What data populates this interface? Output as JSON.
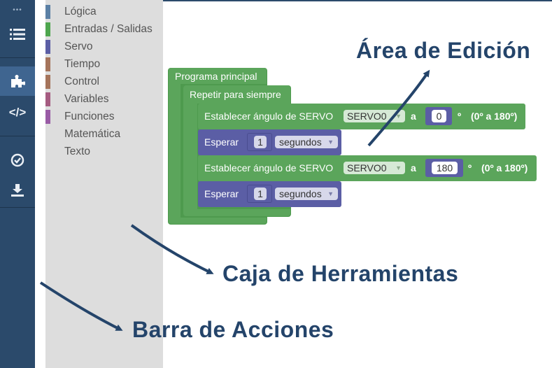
{
  "actionbar": {
    "buttons": [
      {
        "name": "menu-dots-icon",
        "glyph": "•••"
      },
      {
        "name": "list-icon",
        "glyph": "☰"
      },
      {
        "name": "puzzle-icon",
        "glyph": "✚"
      },
      {
        "name": "code-icon",
        "glyph": "</>"
      },
      {
        "name": "check-circle-icon",
        "glyph": "✔"
      },
      {
        "name": "download-icon",
        "glyph": "⤓"
      }
    ]
  },
  "toolbox": {
    "categories": [
      {
        "label": "Lógica",
        "color": "#5b80a5"
      },
      {
        "label": "Entradas / Salidas",
        "color": "#4ea64e"
      },
      {
        "label": "Servo",
        "color": "#5b5ea5"
      },
      {
        "label": "Tiempo",
        "color": "#a5745b"
      },
      {
        "label": "Control",
        "color": "#a5745b"
      },
      {
        "label": "Variables",
        "color": "#a55b80"
      },
      {
        "label": "Funciones",
        "color": "#995ba5"
      },
      {
        "label": "Matemática",
        "color": ""
      },
      {
        "label": "Texto",
        "color": ""
      }
    ]
  },
  "workspace": {
    "program_label": "Programa principal",
    "loop_label": "Repetir para siempre",
    "blocks": [
      {
        "type": "servo",
        "label": "Establecer ángulo de SERVO",
        "servo": "SERVO0",
        "a": "a",
        "angle": "0",
        "unit": "º",
        "range": "(0º a 180º)"
      },
      {
        "type": "wait",
        "label": "Esperar",
        "value": "1",
        "unit": "segundos"
      },
      {
        "type": "servo",
        "label": "Establecer ángulo de SERVO",
        "servo": "SERVO0",
        "a": "a",
        "angle": "180",
        "unit": "º",
        "range": "(0º a 180º)"
      },
      {
        "type": "wait",
        "label": "Esperar",
        "value": "1",
        "unit": "segundos"
      }
    ]
  },
  "annotations": {
    "edit_area": "Área de Edición",
    "toolbox": "Caja de Herramientas",
    "actionbar": "Barra de Acciones"
  },
  "colors": {
    "actionbar": "#2b4a6b",
    "program_green": "#5ba55b",
    "servo_blue": "#5b5ea5",
    "annotation": "#24446a"
  }
}
